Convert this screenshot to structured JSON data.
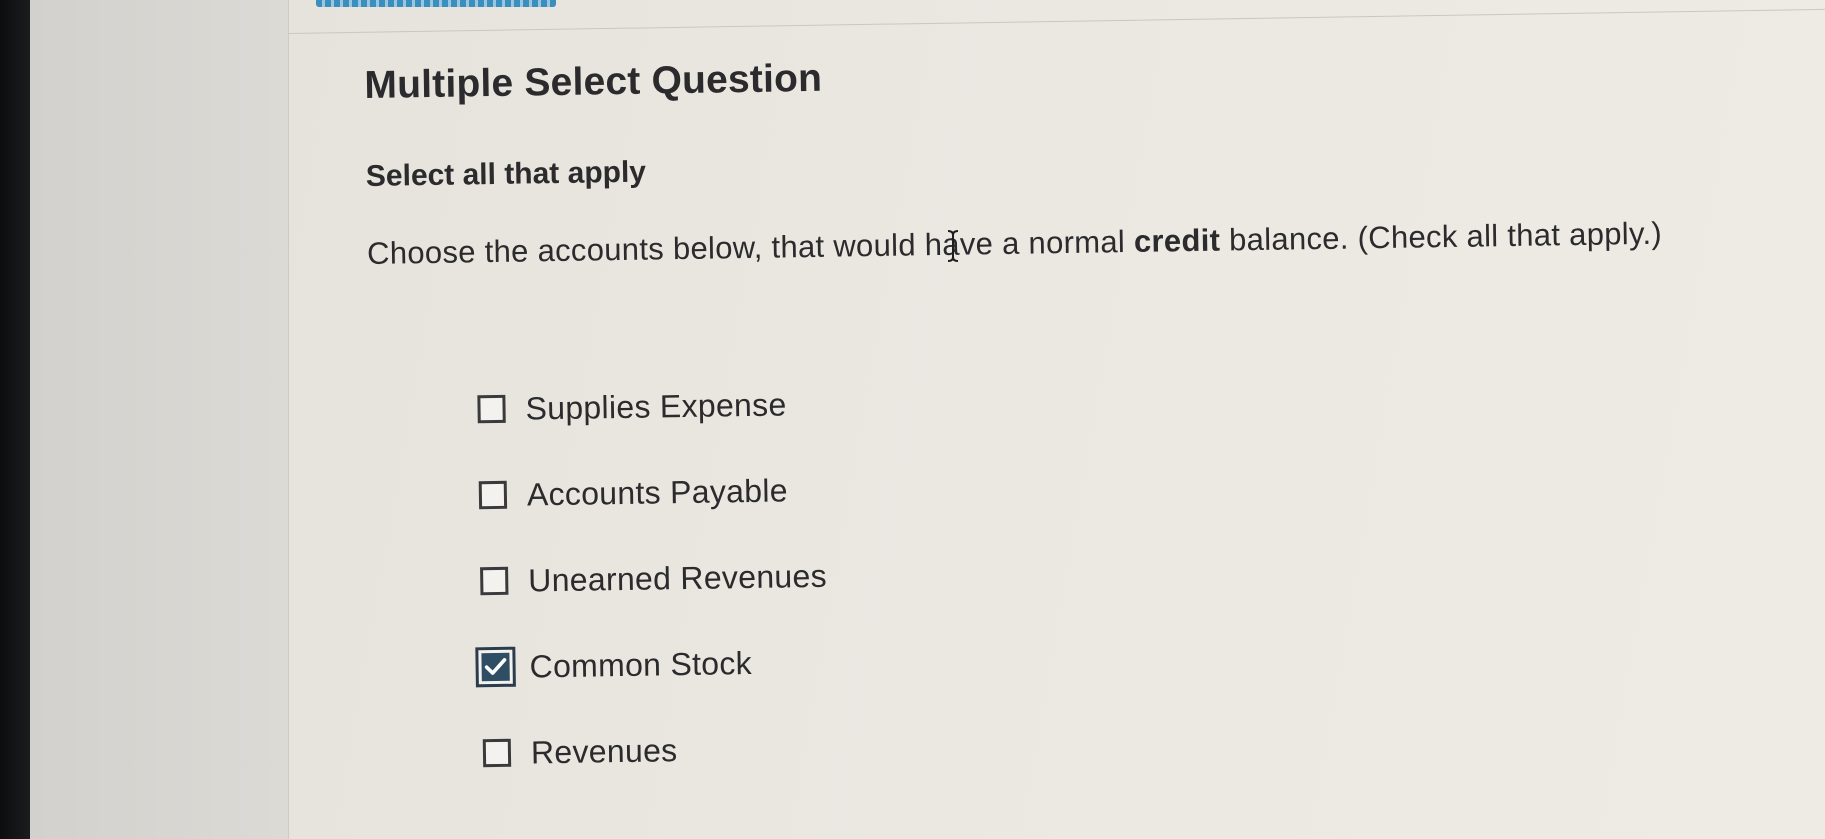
{
  "question": {
    "type_label": "Multiple Select Question",
    "instruction": "Select all that apply",
    "prompt_before": "Choose the accounts below, that would have a normal ",
    "prompt_emphasis": "credit",
    "prompt_after": " balance. (Check all that apply.)"
  },
  "options": [
    {
      "label": "Supplies Expense",
      "checked": false
    },
    {
      "label": "Accounts Payable",
      "checked": false
    },
    {
      "label": "Unearned Revenues",
      "checked": false
    },
    {
      "label": "Common Stock",
      "checked": true
    },
    {
      "label": "Revenues",
      "checked": false
    }
  ],
  "colors": {
    "checked_fill": "#2f4e63",
    "progress_accent": "#3a8fbf",
    "text": "#2b2b2d"
  }
}
